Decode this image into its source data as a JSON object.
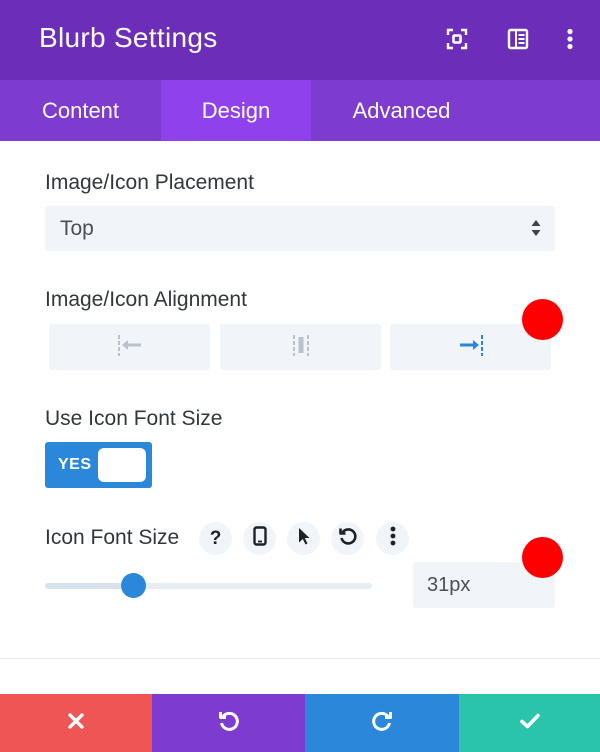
{
  "header": {
    "title": "Blurb Settings",
    "icons": [
      "expand-icon",
      "sidebar-icon",
      "more-vertical-icon"
    ]
  },
  "tabs": [
    {
      "label": "Content",
      "active": false
    },
    {
      "label": "Design",
      "active": true
    },
    {
      "label": "Advanced",
      "active": false
    }
  ],
  "placement": {
    "label": "Image/Icon Placement",
    "value": "Top"
  },
  "alignment": {
    "label": "Image/Icon Alignment",
    "options": [
      "align-left-icon",
      "align-center-icon",
      "align-right-icon"
    ],
    "selected": "align-right-icon"
  },
  "use_icon_font_size": {
    "label": "Use Icon Font Size",
    "toggle_label": "YES",
    "enabled": true
  },
  "icon_font_size": {
    "label": "Icon Font Size",
    "value": "31px",
    "slider_fraction": 0.27,
    "controls": [
      "help-icon",
      "phone-icon",
      "cursor-icon",
      "reset-icon",
      "more-vertical-icon"
    ]
  },
  "footer": {
    "buttons": [
      {
        "name": "cancel-button",
        "icon": "close-icon",
        "color": "#ef5555"
      },
      {
        "name": "undo-button",
        "icon": "undo-icon",
        "color": "#7e3bd0"
      },
      {
        "name": "redo-button",
        "icon": "redo-icon",
        "color": "#2b87da"
      },
      {
        "name": "save-button",
        "icon": "check-icon",
        "color": "#29c4a9"
      }
    ]
  },
  "colors": {
    "header": "#6c2eb9",
    "tabs": "#7d3bcf",
    "active_tab": "#8f42ec",
    "accent": "#2b87da",
    "marker": "#ff0000"
  }
}
